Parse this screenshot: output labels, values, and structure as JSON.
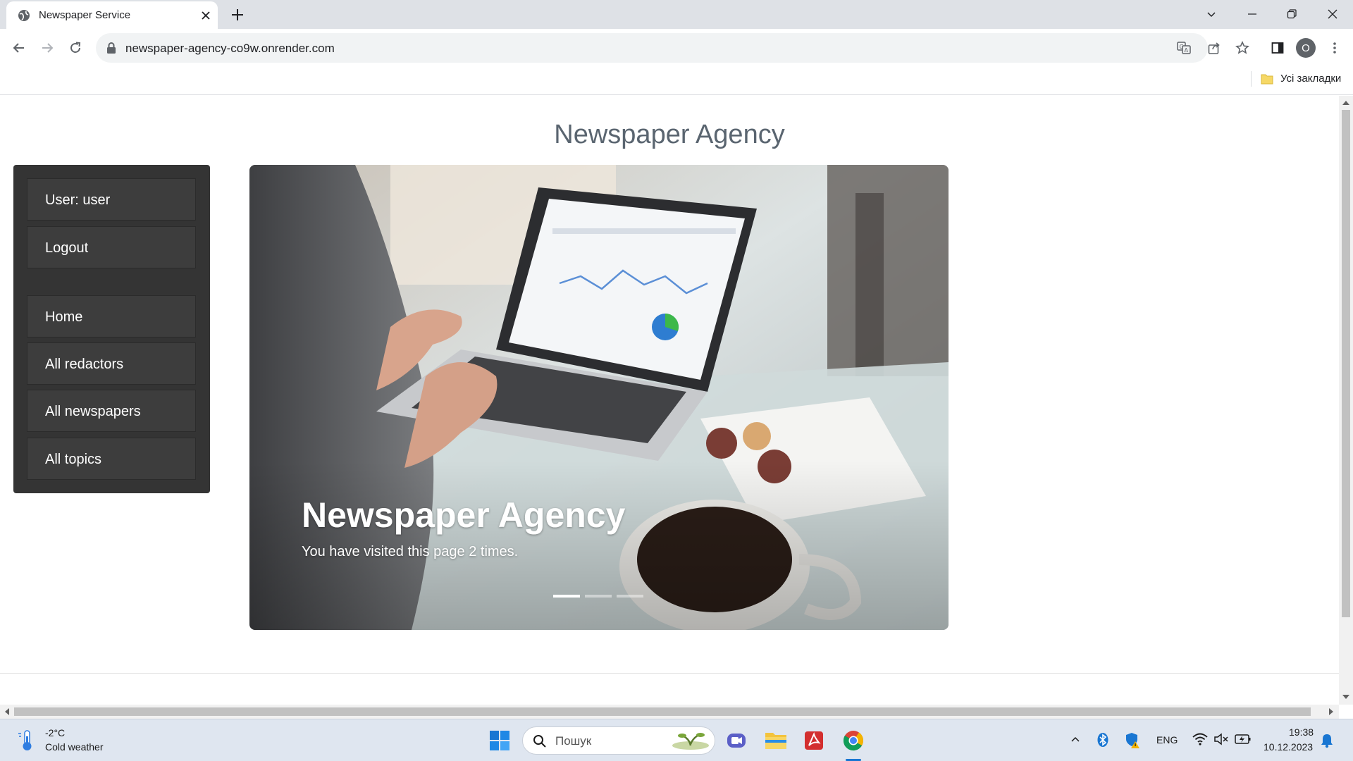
{
  "browser": {
    "tab_title": "Newspaper Service",
    "url": "newspaper-agency-co9w.onrender.com",
    "profile_initial": "O",
    "bookmarks_label": "Усі закладки"
  },
  "page": {
    "heading": "Newspaper Agency",
    "sidebar": {
      "user_label": "User: user",
      "logout_label": "Logout",
      "nav": [
        "Home",
        "All redactors",
        "All newspapers",
        "All topics"
      ]
    },
    "carousel": {
      "title": "Newspaper Agency",
      "caption": "You have visited this page 2 times.",
      "indicator_count": 3,
      "active_index": 0
    }
  },
  "taskbar": {
    "weather_temp": "-2°C",
    "weather_desc": "Cold weather",
    "search_placeholder": "Пошук",
    "language": "ENG",
    "time": "19:38",
    "date": "10.12.2023"
  }
}
